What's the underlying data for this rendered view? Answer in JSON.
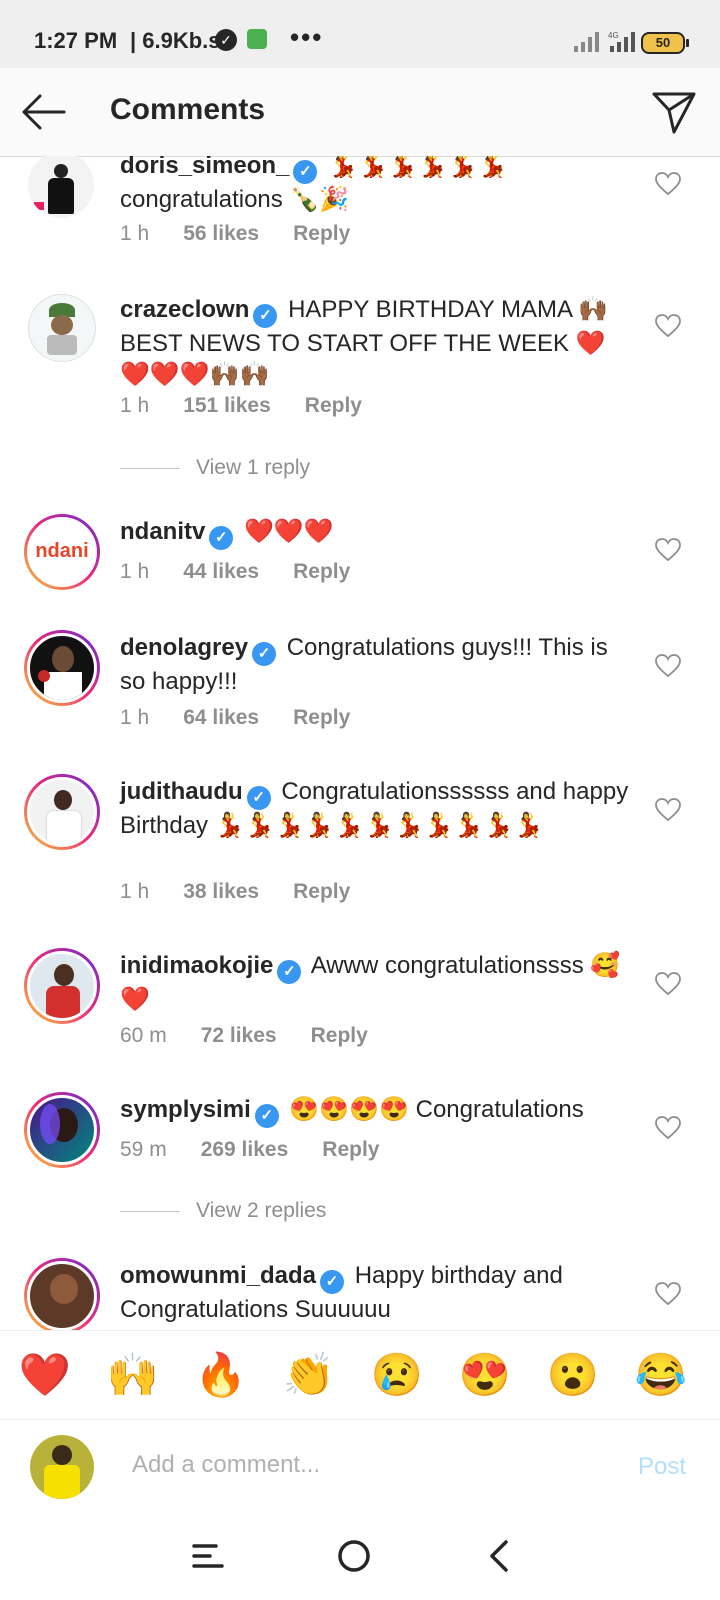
{
  "status": {
    "time": "1:27 PM",
    "speed": "| 6.9Kb.s",
    "more": "•••",
    "battery": "50"
  },
  "header": {
    "title": "Comments"
  },
  "comments": [
    {
      "username": "doris_simeon_",
      "text": "💃💃💃💃💃💃 congratulations 🍾🎉",
      "time": "1 h",
      "likes": "56 likes",
      "reply": "Reply"
    },
    {
      "username": "crazeclown",
      "text": "HAPPY BIRTHDAY MAMA 🙌🏾 BEST NEWS TO START OFF THE WEEK ❤️❤️❤️❤️🙌🏾🙌🏾",
      "time": "1 h",
      "likes": "151 likes",
      "reply": "Reply"
    },
    {
      "username": "ndanitv",
      "text": "❤️❤️❤️",
      "time": "1 h",
      "likes": "44 likes",
      "reply": "Reply"
    },
    {
      "username": "denolagrey",
      "text": "Congratulations guys!!! This is so happy!!!",
      "time": "1 h",
      "likes": "64 likes",
      "reply": "Reply"
    },
    {
      "username": "judithaudu",
      "text": "Congratulationssssss and happy Birthday 💃💃💃💃💃💃💃💃💃💃💃",
      "time": "1 h",
      "likes": "38 likes",
      "reply": "Reply"
    },
    {
      "username": "inidimaokojie",
      "text": "Awww congratulationssss 🥰❤️",
      "time": "60 m",
      "likes": "72 likes",
      "reply": "Reply"
    },
    {
      "username": "symplysimi",
      "text": "😍😍😍😍 Congratulations",
      "time": "59 m",
      "likes": "269 likes",
      "reply": "Reply"
    },
    {
      "username": "omowunmi_dada",
      "text": "Happy birthday and Congratulations Suuuuuu",
      "time": "",
      "likes": "",
      "reply": ""
    }
  ],
  "view_replies": [
    "View 1 reply",
    "View 2 replies"
  ],
  "reactions": [
    "❤️",
    "🙌",
    "🔥",
    "👏",
    "😢",
    "😍",
    "😮",
    "😂"
  ],
  "input": {
    "placeholder": "Add a comment...",
    "post_label": "Post"
  }
}
